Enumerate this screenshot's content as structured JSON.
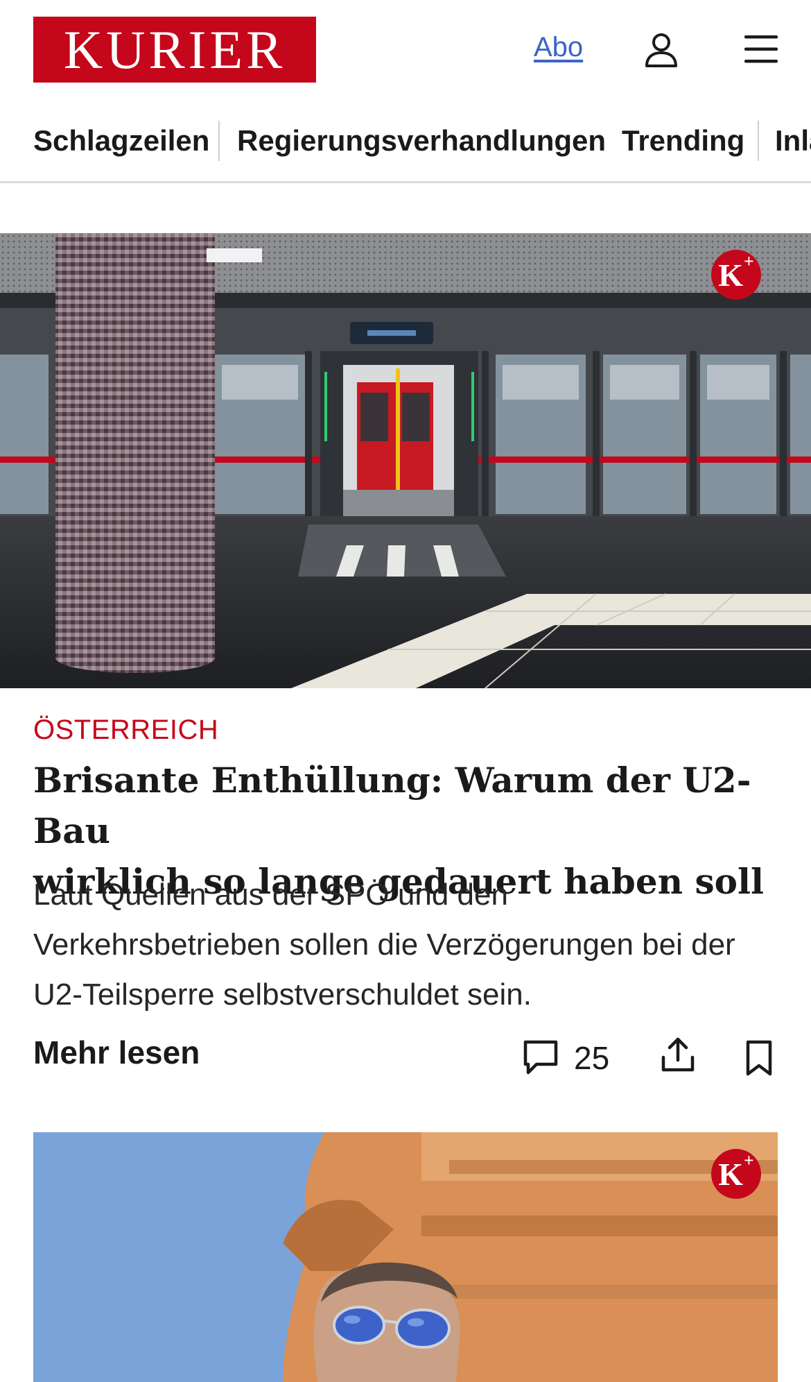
{
  "header": {
    "logo_text": "KURIER",
    "abo_label": "Abo",
    "user_icon": "user-icon",
    "menu_icon": "hamburger-menu-icon"
  },
  "nav": {
    "items": [
      "Schlagzeilen",
      "Regierungsverhandlungen",
      "Trending",
      "Inland"
    ]
  },
  "colors": {
    "brand_red": "#c4071b",
    "link_blue": "#3a64c8",
    "text": "#1a1a1a"
  },
  "article": {
    "badge": "K+",
    "category": "ÖSTERREICH",
    "headline_line1": "Brisante Enthüllung: Warum der U2-Bau",
    "headline_line2": "wirklich so lange gedauert haben soll",
    "teaser_line1": "Laut Quellen aus der SPÖ und den",
    "teaser_line2": "Verkehrsbetrieben sollen die Verzögerungen bei der",
    "teaser_line3": "U2-Teilsperre selbstverschuldet sein.",
    "more_label": "Mehr lesen",
    "comment_count": "25"
  },
  "article2": {
    "badge": "K+"
  }
}
